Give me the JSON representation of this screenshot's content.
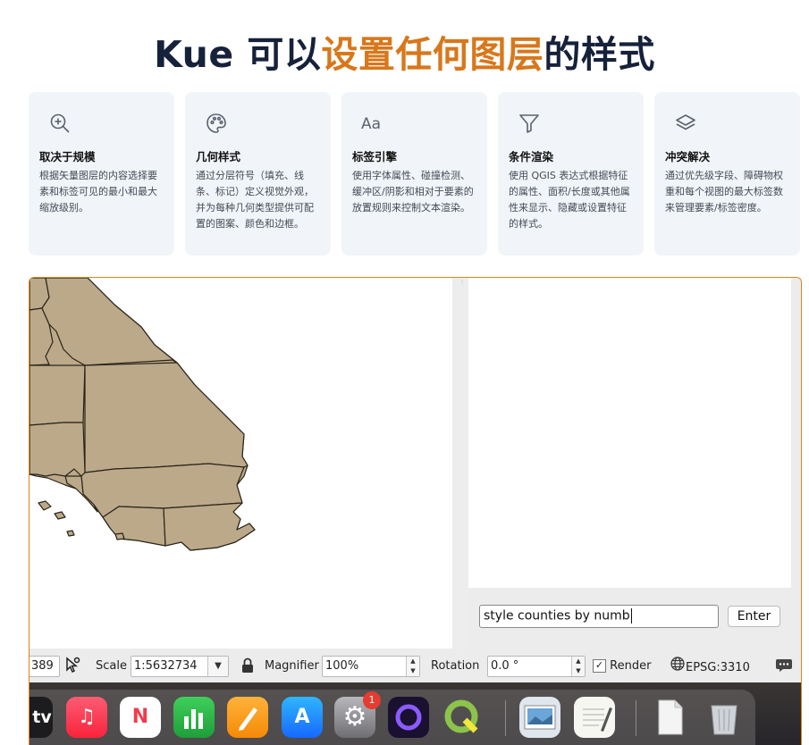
{
  "hero": {
    "title_prefix": "Kue 可以",
    "title_accent": "设置任何图层",
    "title_suffix": "的样式"
  },
  "colors": {
    "accent": "#d8771b",
    "title": "#16213a",
    "card_bg": "#f1f4f8",
    "land_fill": "#bba98a",
    "app_border": "#d8851f"
  },
  "features": [
    {
      "icon": "zoom-in-icon",
      "title": "取决于规模",
      "description": "根据矢量图层的内容选择要素和标签可见的最小和最大缩放级别。"
    },
    {
      "icon": "palette-icon",
      "title": "几何样式",
      "description": "通过分层符号（填充、线条、标记）定义视觉外观，并为每种几何类型提供可配置的图案、颜色和边框。"
    },
    {
      "icon": "font-aa-icon",
      "icon_text": "Aa",
      "title": "标签引擎",
      "description": "使用字体属性、碰撞检测、缓冲区/阴影和相对于要素的放置规则来控制文本渲染。"
    },
    {
      "icon": "filter-icon",
      "title": "条件渲染",
      "description": "使用 QGIS 表达式根据特征的属性、面积/长度或其他属性来显示、隐藏或设置特征的样式。"
    },
    {
      "icon": "layers-icon",
      "title": "冲突解决",
      "description": "通过优先级字段、障碍物权重和每个视图的最大标签数来管理要素/标签密度。"
    }
  ],
  "console": {
    "input_value": "style counties by numb",
    "enter_label": "Enter"
  },
  "statusbar": {
    "coordinate_fragment": "389",
    "scale_label": "Scale",
    "scale_value": "1:5632734",
    "magnifier_label": "Magnifier",
    "magnifier_value": "100%",
    "rotation_label": "Rotation",
    "rotation_value": "0.0 °",
    "render_label": "Render",
    "render_checked": true,
    "crs_label": "EPSG:3310"
  },
  "dock": {
    "apps": [
      {
        "name": "apple-tv",
        "glyph": "tv"
      },
      {
        "name": "music",
        "glyph": "♫"
      },
      {
        "name": "news",
        "glyph": "N"
      },
      {
        "name": "numbers",
        "glyph": ""
      },
      {
        "name": "pages",
        "glyph": ""
      },
      {
        "name": "app-store",
        "glyph": "A"
      },
      {
        "name": "system-settings",
        "glyph": "⚙",
        "badge": "1"
      },
      {
        "name": "arc-ring",
        "glyph": ""
      },
      {
        "name": "qgis",
        "glyph": "Q"
      },
      {
        "name": "preview",
        "glyph": ""
      },
      {
        "name": "textedit",
        "glyph": ""
      },
      {
        "name": "document",
        "glyph": ""
      },
      {
        "name": "trash",
        "glyph": ""
      }
    ]
  }
}
